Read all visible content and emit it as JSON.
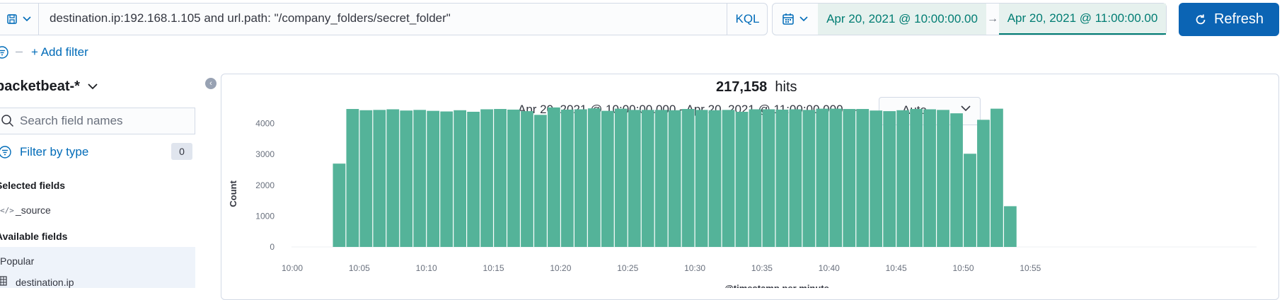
{
  "query_bar": {
    "query": "destination.ip:192.168.1.105 and url.path: \"/company_folders/secret_folder\"",
    "language": "KQL"
  },
  "time_picker": {
    "start": "Apr 20, 2021 @ 10:00:00.00",
    "end": "Apr 20, 2021 @ 11:00:00.00",
    "arrow": "→",
    "refresh_label": "Refresh"
  },
  "filters": {
    "add_label": "+ Add filter"
  },
  "sidebar": {
    "index_pattern": "packetbeat-*",
    "search_placeholder": "Search field names",
    "filter_type_label": "Filter by type",
    "filter_type_count": "0",
    "selected_heading": "Selected fields",
    "selected_fields": [
      "_source"
    ],
    "available_heading": "Available fields",
    "popular_label": "Popular",
    "popular_fields": [
      "destination.ip"
    ]
  },
  "main": {
    "hits_count": "217,158",
    "hits_label": "hits",
    "range_text": "Apr 20, 2021 @ 10:00:00.000 - Apr 20, 2021 @ 11:00:00.000 —",
    "interval": "Auto"
  },
  "colors": {
    "accent": "#006bb8",
    "bar": "#54b399",
    "refresh_bg": "#0b64b4",
    "date_text": "#017d73"
  },
  "chart_data": {
    "type": "bar",
    "ylabel": "Count",
    "xlabel": "@timestamp per minute",
    "ylim": [
      0,
      4700
    ],
    "yticks": [
      0,
      1000,
      2000,
      3000,
      4000
    ],
    "xticks": [
      "10:00",
      "10:05",
      "10:10",
      "10:15",
      "10:20",
      "10:25",
      "10:30",
      "10:35",
      "10:40",
      "10:45",
      "10:50",
      "10:55"
    ],
    "x_range_minutes": [
      0,
      60
    ],
    "minutes": [
      3,
      4,
      5,
      6,
      7,
      8,
      9,
      10,
      11,
      12,
      13,
      14,
      15,
      16,
      17,
      18,
      19,
      20,
      21,
      22,
      23,
      24,
      25,
      26,
      27,
      28,
      29,
      30,
      31,
      32,
      33,
      34,
      35,
      36,
      37,
      38,
      39,
      40,
      41,
      42,
      43,
      44,
      45,
      46,
      47,
      48,
      49,
      50,
      51,
      52,
      53
    ],
    "values": [
      2700,
      4470,
      4430,
      4440,
      4460,
      4420,
      4440,
      4410,
      4390,
      4430,
      4380,
      4460,
      4470,
      4450,
      4400,
      4280,
      4520,
      4450,
      4460,
      4490,
      4410,
      4480,
      4440,
      4440,
      4440,
      4430,
      4470,
      4440,
      4430,
      4440,
      4380,
      4460,
      4460,
      4450,
      4460,
      4440,
      4480,
      4480,
      4470,
      4470,
      4420,
      4400,
      4430,
      4470,
      4460,
      4440,
      4330,
      3020,
      4120,
      4480,
      1320
    ]
  }
}
